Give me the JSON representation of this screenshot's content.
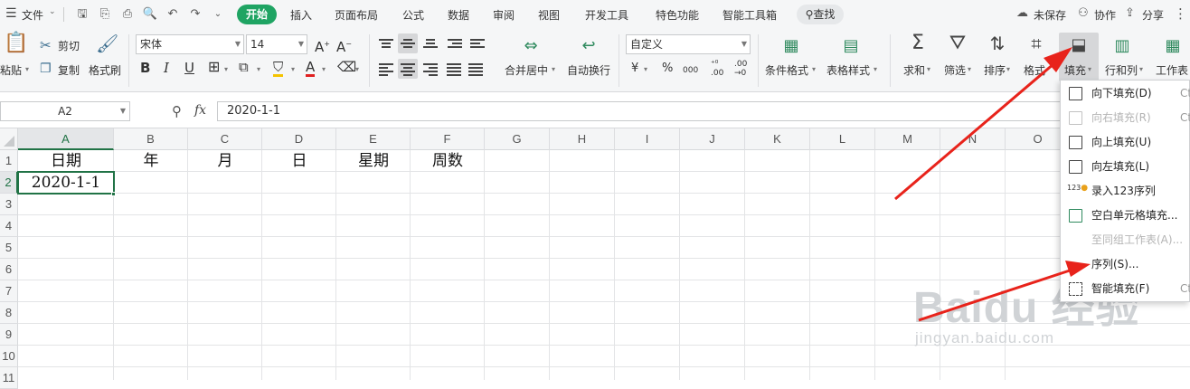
{
  "menubar": {
    "file_menu": "文件",
    "tabs": [
      "开始",
      "插入",
      "页面布局",
      "公式",
      "数据",
      "审阅",
      "视图",
      "开发工具",
      "特色功能",
      "智能工具箱"
    ],
    "search": "查找",
    "unsaved": "未保存",
    "collab": "协作",
    "share": "分享"
  },
  "ribbon": {
    "paste": "粘贴",
    "cut": "剪切",
    "copy": "复制",
    "format_painter": "格式刷",
    "font_name": "宋体",
    "font_size": "14",
    "bold": "B",
    "italic": "I",
    "underline": "U",
    "font_color_letter": "A",
    "merge_center": "合并居中",
    "wrap_text": "自动换行",
    "number_format": "自定义",
    "currency": "¥",
    "percent": "%",
    "thousands": "000",
    "conditional_format": "条件格式",
    "table_style": "表格样式",
    "sum": "求和",
    "filter": "筛选",
    "sort": "排序",
    "format": "格式",
    "fill": "填充",
    "row_col": "行和列",
    "worksheet": "工作表"
  },
  "formula_bar": {
    "name_box": "A2",
    "fx": "fx",
    "formula": "2020-1-1"
  },
  "sheet": {
    "columns": [
      "A",
      "B",
      "C",
      "D",
      "E",
      "F",
      "G",
      "H",
      "I",
      "J",
      "K",
      "L",
      "M",
      "N",
      "O"
    ],
    "rows": [
      "1",
      "2",
      "3",
      "4",
      "5",
      "6",
      "7",
      "8",
      "9",
      "10",
      "11"
    ],
    "cells": {
      "A1": "日期",
      "B1": "年",
      "C1": "月",
      "D1": "日",
      "E1": "星期",
      "F1": "周数",
      "A2": "2020-1-1"
    }
  },
  "fill_menu": {
    "items": [
      {
        "label": "向下填充(D)",
        "shortcut": "Ct",
        "enabled": true
      },
      {
        "label": "向右填充(R)",
        "shortcut": "Ct",
        "enabled": false
      },
      {
        "label": "向上填充(U)",
        "shortcut": "",
        "enabled": true
      },
      {
        "label": "向左填充(L)",
        "shortcut": "",
        "enabled": true
      },
      {
        "label": "录入123序列",
        "shortcut": "",
        "enabled": true
      },
      {
        "label": "空白单元格填充...",
        "shortcut": "",
        "enabled": true
      },
      {
        "label": "至同组工作表(A)...",
        "shortcut": "",
        "enabled": false
      },
      {
        "label": "序列(S)...",
        "shortcut": "",
        "enabled": true
      },
      {
        "label": "智能填充(F)",
        "shortcut": "Ct",
        "enabled": true
      }
    ]
  },
  "watermark": {
    "line1": "Baidu 经验",
    "line2": "jingyan.baidu.com"
  },
  "colors": {
    "accent": "#1fa463",
    "annotation_arrow": "#e8231b",
    "selection": "#217346"
  }
}
